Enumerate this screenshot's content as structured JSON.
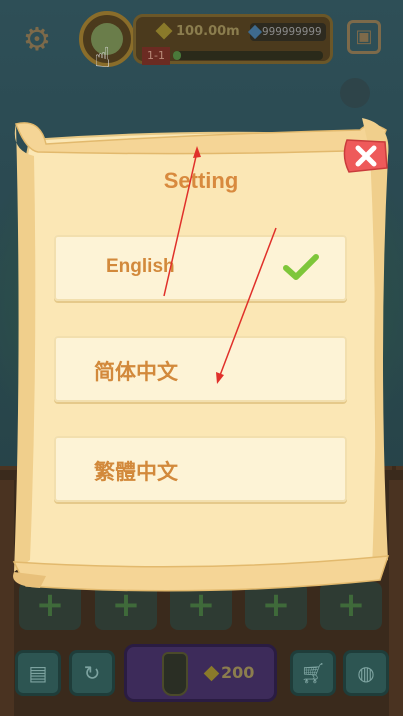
{
  "hud": {
    "gold": "100.00m",
    "gems": "999999999",
    "level": "1-1",
    "progress": 0.05
  },
  "dialog": {
    "title": "Setting",
    "options": [
      {
        "label": "English",
        "selected": true
      },
      {
        "label": "简体中文",
        "selected": false
      },
      {
        "label": "繁體中文",
        "selected": false
      }
    ]
  },
  "bottom_bar": {
    "buy_cost": "200"
  },
  "colors": {
    "title": "#d88a3e",
    "option_text": "#d2893b",
    "parchment": "#fbe7b5",
    "close_red": "#ee5a5a",
    "check_green": "#7ec63a",
    "annotation_red": "#e0302a"
  },
  "icons": [
    "gear-icon",
    "calendar-icon",
    "hand-pointer-icon",
    "close-icon",
    "check-icon",
    "plus-icon",
    "cart-icon",
    "bag-icon",
    "refresh-icon",
    "trash-icon"
  ]
}
